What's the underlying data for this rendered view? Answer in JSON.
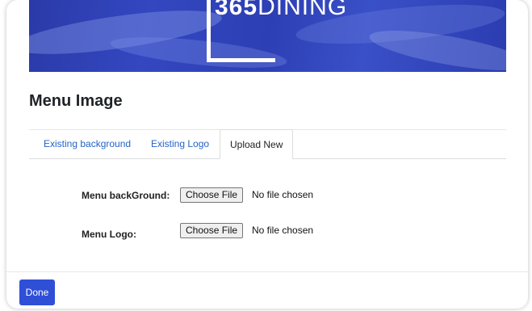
{
  "banner": {
    "logo_number": "365",
    "logo_word": "DINING"
  },
  "section": {
    "title": "Menu Image"
  },
  "tabs": [
    {
      "label": "Existing background",
      "active": false
    },
    {
      "label": "Existing Logo",
      "active": false
    },
    {
      "label": "Upload New",
      "active": true
    }
  ],
  "form": {
    "background": {
      "label": "Menu backGround:",
      "button": "Choose File",
      "status": "No file chosen"
    },
    "logo": {
      "label": "Menu Logo:",
      "button": "Choose File",
      "status": "No file chosen"
    }
  },
  "footer": {
    "done_label": "Done"
  },
  "colors": {
    "primary": "#2f4fd6",
    "link": "#2563c8",
    "banner": "#3447c0"
  }
}
